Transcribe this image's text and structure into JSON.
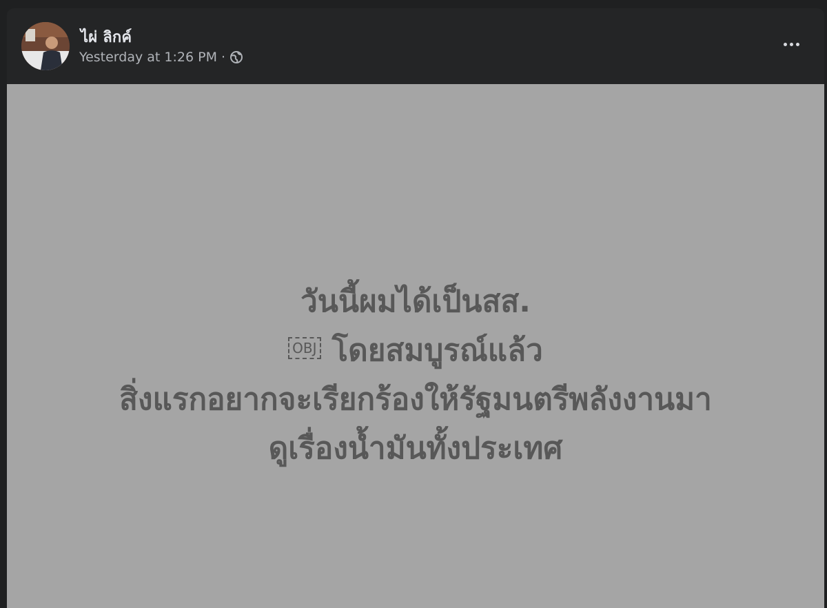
{
  "post": {
    "author": "ไผ่ ลิกค์",
    "timestamp": "Yesterday at 1:26 PM",
    "separator": "·",
    "privacy_icon": "globe-icon",
    "more_icon": "more-horizontal-icon",
    "text_lines": [
      "วันนี้ผมได้เป็นสส.",
      "โดยสมบูรณ์แล้ว",
      "สิ่งแรกอยากจะเรียกร้องให้รัฐมนตรีพลังงานมา",
      "ดูเรื่องน้ำมันทั้งประเทศ"
    ],
    "inline_object_label": "OBJ",
    "background_color": "#a5a5a5",
    "text_color": "#585858"
  }
}
